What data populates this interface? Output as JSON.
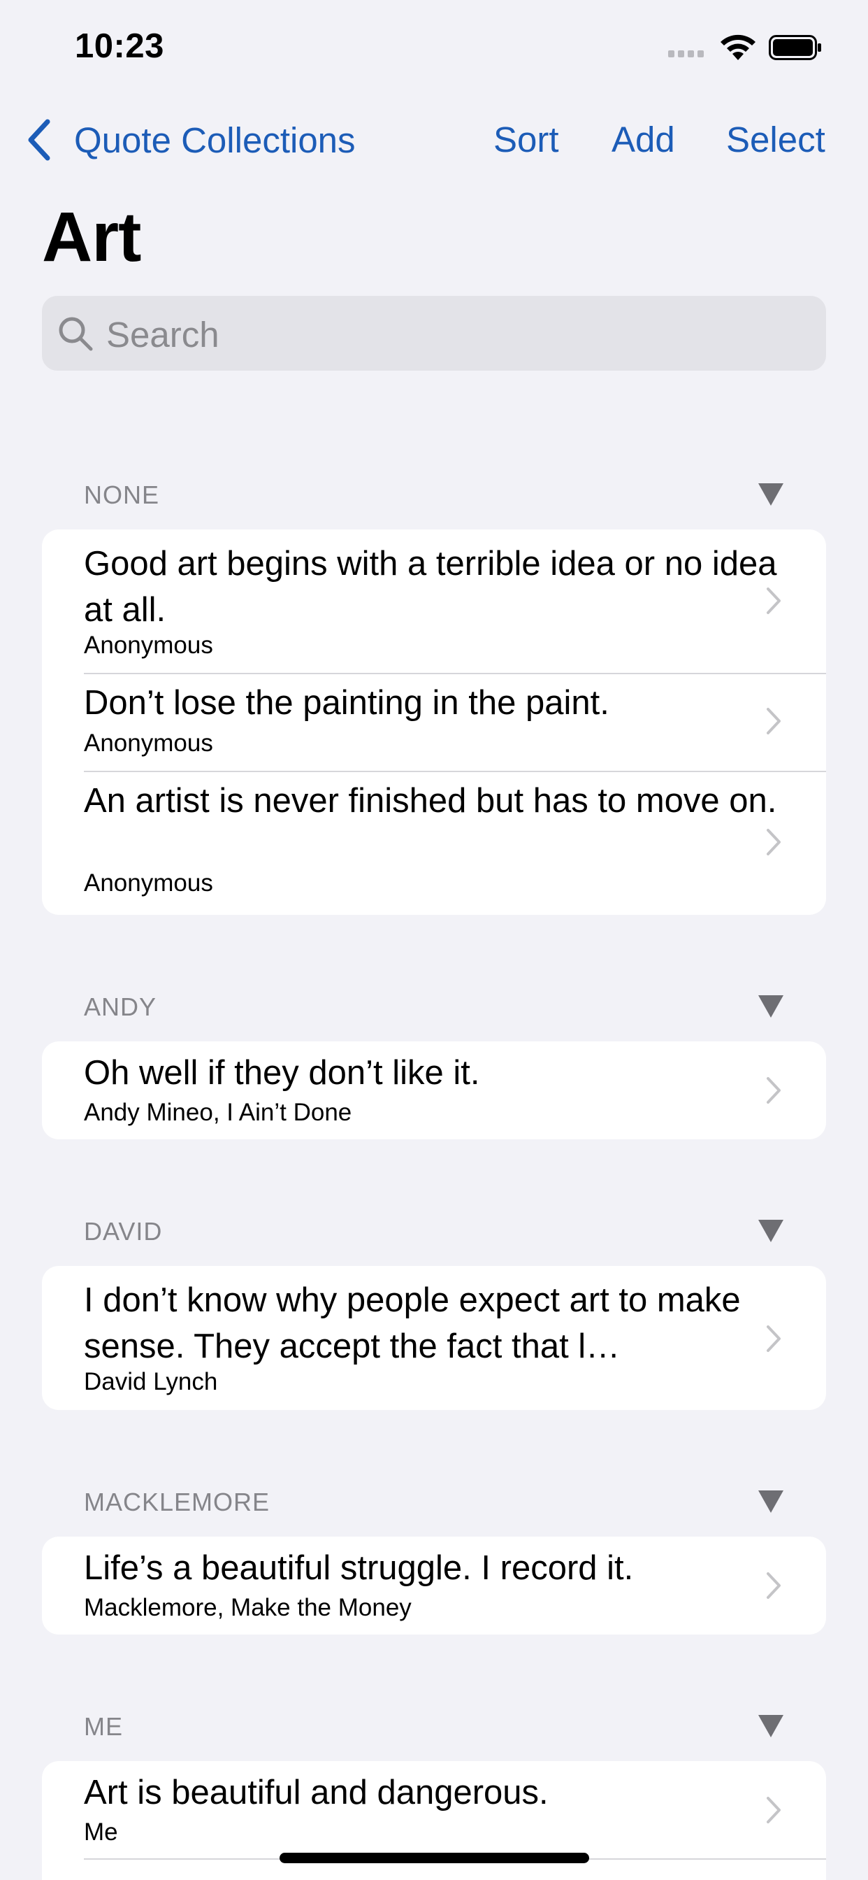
{
  "status": {
    "time": "10:23"
  },
  "nav": {
    "back_label": "Quote Collections",
    "sort": "Sort",
    "add": "Add",
    "select": "Select"
  },
  "title": "Art",
  "search": {
    "placeholder": "Search"
  },
  "sections": [
    {
      "header": "NONE",
      "rows": [
        {
          "quote": "Good art begins with a terrible idea or no idea at all.",
          "author": "Anonymous"
        },
        {
          "quote": "Don’t lose the painting in the paint.",
          "author": "Anonymous"
        },
        {
          "quote": "An artist is never finished but has to move on.",
          "author": "Anonymous"
        }
      ]
    },
    {
      "header": "ANDY",
      "rows": [
        {
          "quote": "Oh well if they don’t like it.",
          "author": "Andy Mineo, I Ain’t Done"
        }
      ]
    },
    {
      "header": "DAVID",
      "rows": [
        {
          "quote": "I don’t know why people expect art to make sense. They accept the fact that l…",
          "author": "David Lynch"
        }
      ]
    },
    {
      "header": "MACKLEMORE",
      "rows": [
        {
          "quote": "Life’s a beautiful struggle. I record it.",
          "author": "Macklemore, Make the Money"
        }
      ]
    },
    {
      "header": "ME",
      "rows": [
        {
          "quote": "Art is beautiful and dangerous.",
          "author": "Me"
        }
      ]
    }
  ],
  "colors": {
    "accent": "#1c5cb7",
    "background": "#f2f2f7",
    "secondary_text": "#85858a"
  }
}
